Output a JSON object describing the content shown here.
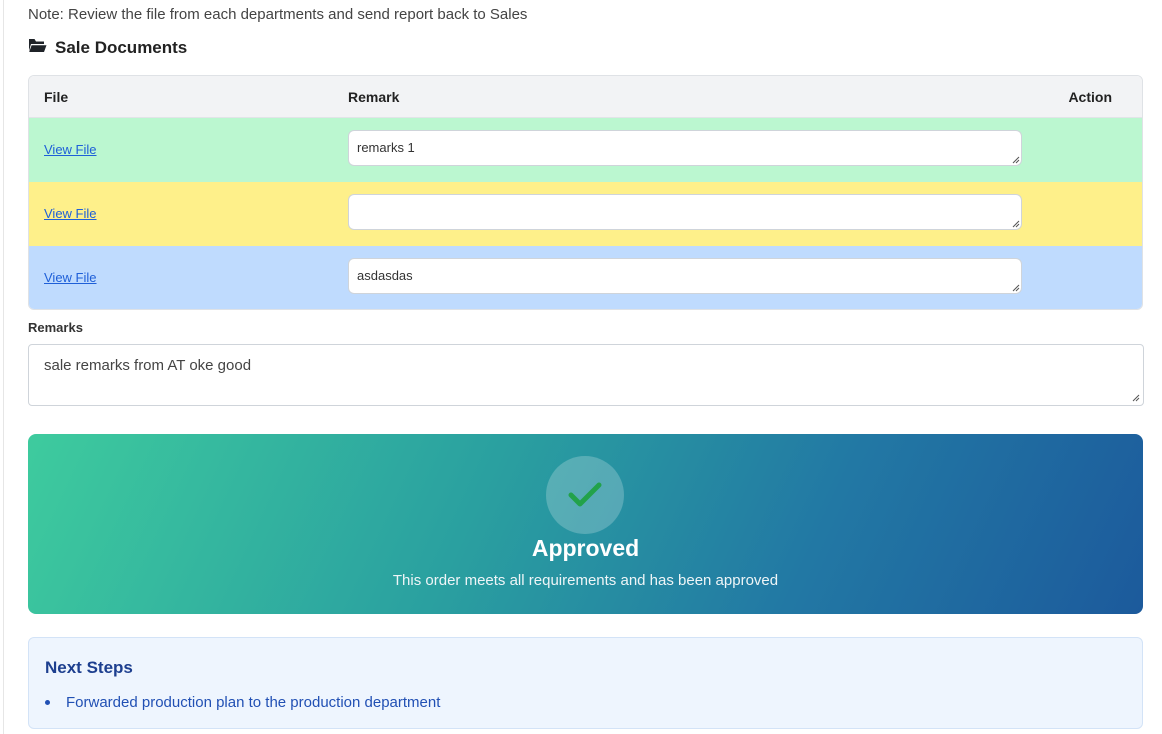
{
  "note": "Note: Review the file from each departments and send report back to Sales",
  "section": {
    "title": "Sale Documents",
    "icon": "folder-open-icon"
  },
  "table": {
    "headers": {
      "file": "File",
      "remark": "Remark",
      "action": "Action"
    },
    "rows": [
      {
        "file_link": "View File",
        "remark": "remarks 1",
        "row_color": "#bbf7d0"
      },
      {
        "file_link": "View File",
        "remark": "",
        "row_color": "#fef08a"
      },
      {
        "file_link": "View File",
        "remark": "asdasdas",
        "row_color": "#bfdbfe"
      }
    ]
  },
  "remarks": {
    "label": "Remarks",
    "value": "sale remarks from AT oke good"
  },
  "status": {
    "title": "Approved",
    "message": "This order meets all requirements and has been approved",
    "icon": "check-icon",
    "check_color": "#22a24a"
  },
  "next_steps": {
    "title": "Next Steps",
    "items": [
      "Forwarded production plan to the production department"
    ]
  }
}
